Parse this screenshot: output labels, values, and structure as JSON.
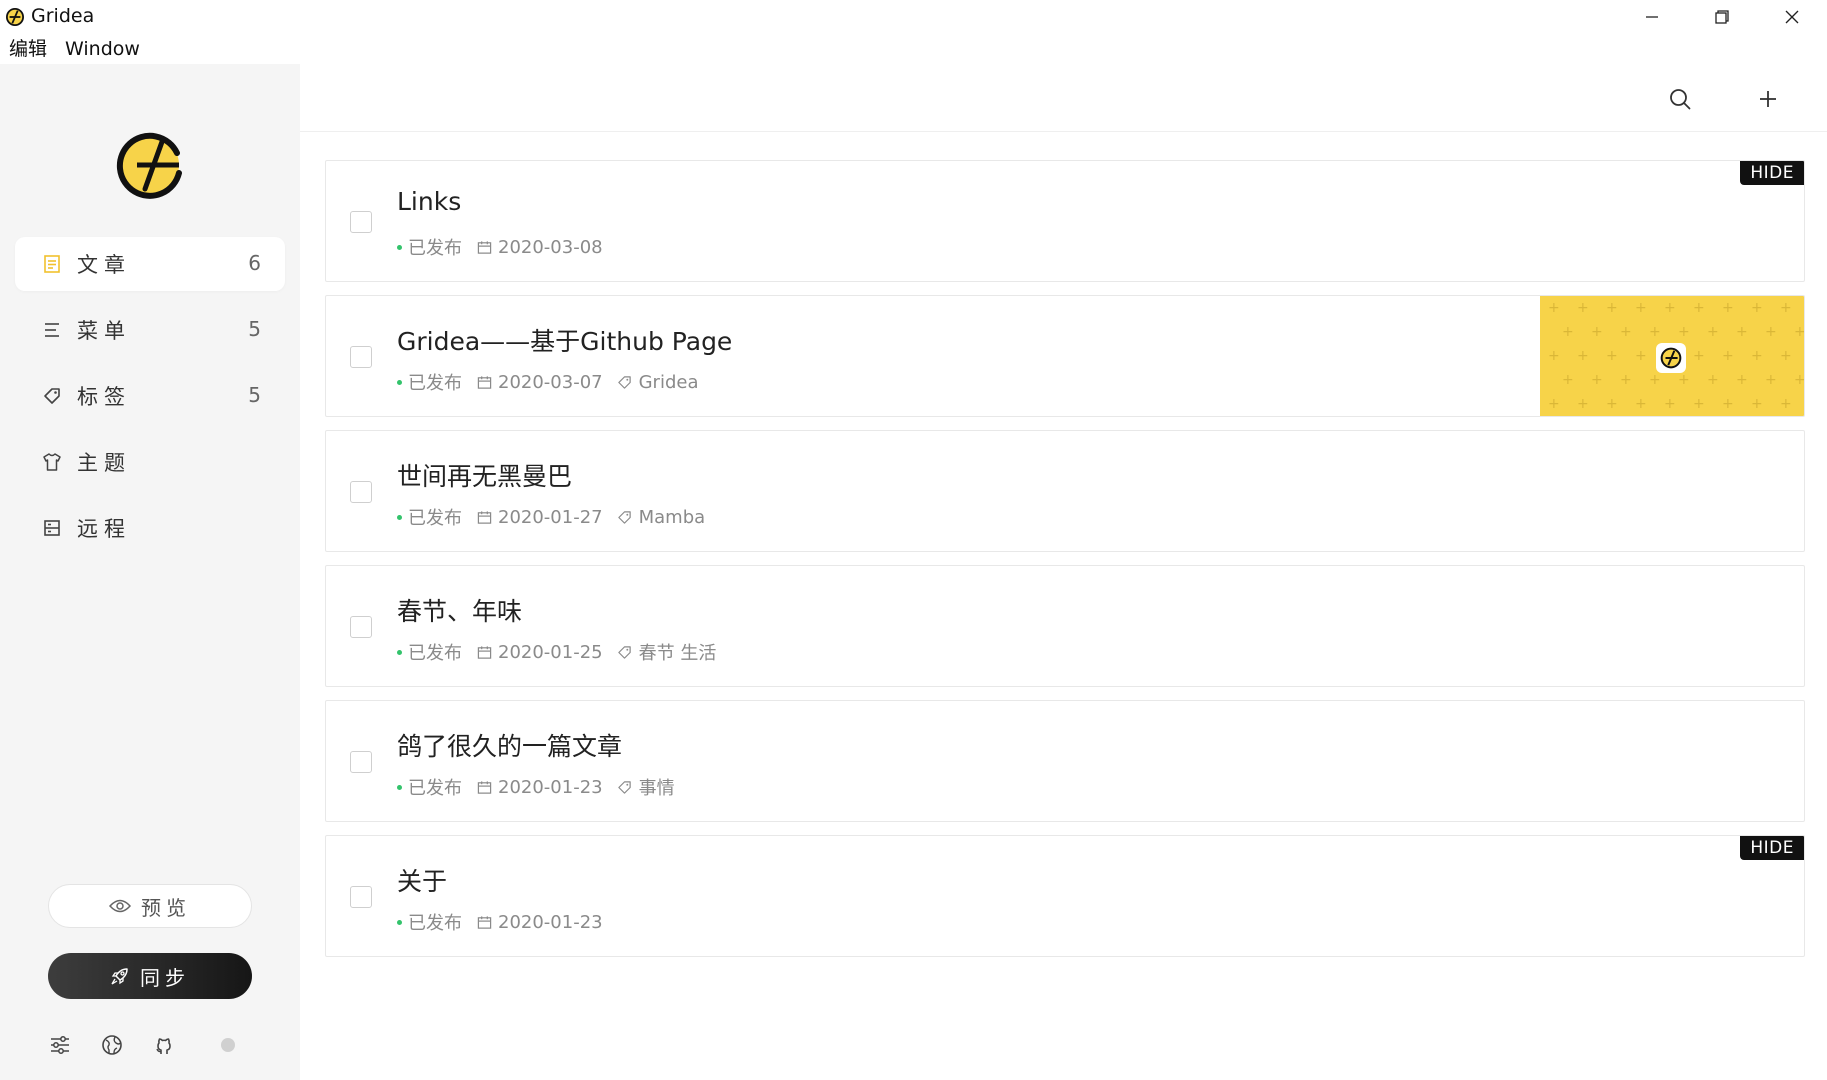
{
  "window": {
    "title": "Gridea",
    "controls": [
      "minimize-icon",
      "restore-icon",
      "close-icon"
    ]
  },
  "menu": [
    {
      "label": "编辑"
    },
    {
      "label": "Window"
    }
  ],
  "sidebar": {
    "items": [
      {
        "label": "文章",
        "count": "6",
        "icon": "article-icon",
        "active": true
      },
      {
        "label": "菜单",
        "count": "5",
        "icon": "menu-icon",
        "active": false
      },
      {
        "label": "标签",
        "count": "5",
        "icon": "tag-icon",
        "active": false
      },
      {
        "label": "主题",
        "count": "",
        "icon": "theme-icon",
        "active": false
      },
      {
        "label": "远程",
        "count": "",
        "icon": "remote-icon",
        "active": false
      }
    ],
    "preview_label": "预览",
    "sync_label": "同步",
    "bottom_icons": [
      "settings-icon",
      "globe-icon",
      "github-icon",
      "status-dot"
    ]
  },
  "toolbar": {
    "icons": [
      "search-icon",
      "add-icon"
    ]
  },
  "posts": [
    {
      "title": "Links",
      "status": "已发布",
      "date": "2020-03-08",
      "tags": "",
      "badge": "HIDE",
      "has_feature_image": false
    },
    {
      "title": "Gridea——基于Github Page",
      "status": "已发布",
      "date": "2020-03-07",
      "tags": "Gridea",
      "badge": "",
      "has_feature_image": true
    },
    {
      "title": "世间再无黑曼巴",
      "status": "已发布",
      "date": "2020-01-27",
      "tags": "Mamba",
      "badge": "",
      "has_feature_image": false
    },
    {
      "title": "春节、年味",
      "status": "已发布",
      "date": "2020-01-25",
      "tags": "春节 生活",
      "badge": "",
      "has_feature_image": false
    },
    {
      "title": "鸽了很久的一篇文章",
      "status": "已发布",
      "date": "2020-01-23",
      "tags": "事情",
      "badge": "",
      "has_feature_image": false
    },
    {
      "title": "关于",
      "status": "已发布",
      "date": "2020-01-23",
      "tags": "",
      "badge": "HIDE",
      "has_feature_image": false
    }
  ],
  "colors": {
    "accent_yellow": "#f7d349",
    "published_green": "#33c36b",
    "sidebar_bg": "#f5f5f5",
    "sync_dark": "#222222"
  }
}
